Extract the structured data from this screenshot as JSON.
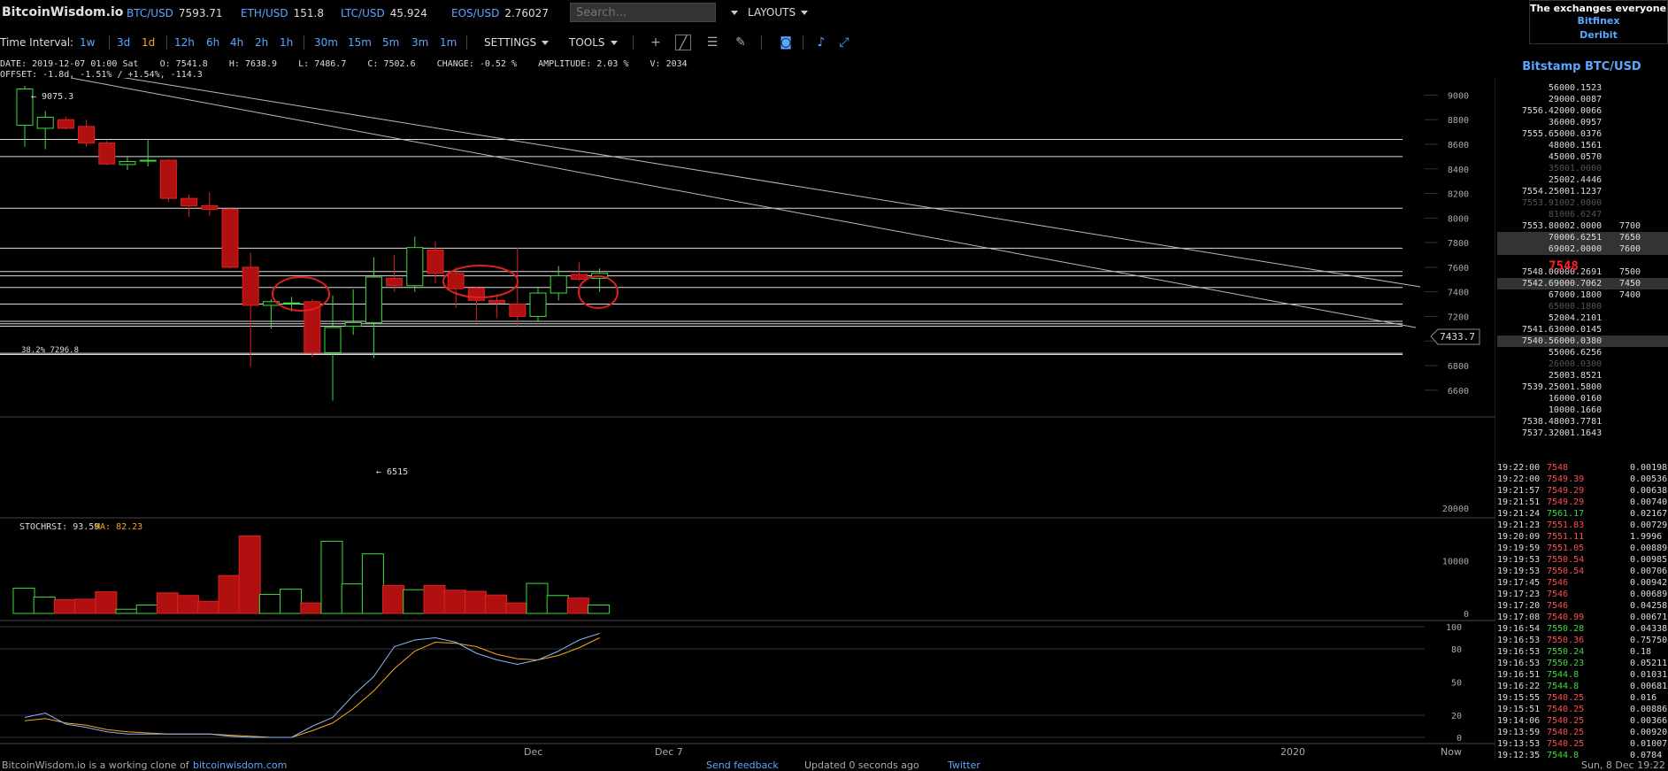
{
  "site": {
    "logo": "BitcoinWisdom.io"
  },
  "tickers": [
    {
      "sym": "BTC/USD",
      "val": "7593.71"
    },
    {
      "sym": "ETH/USD",
      "val": "151.8"
    },
    {
      "sym": "LTC/USD",
      "val": "45.924"
    },
    {
      "sym": "EOS/USD",
      "val": "2.76027"
    }
  ],
  "search": {
    "placeholder": "Search..."
  },
  "layouts_label": "LAYOUTS",
  "ad": {
    "title": "The exchanges everyone us",
    "links": [
      "Bitfinex",
      "Deribit"
    ]
  },
  "toolbar": {
    "time_interval_label": "Time Interval:",
    "intervals": [
      "1w",
      "3d",
      "1d",
      "12h",
      "6h",
      "4h",
      "2h",
      "1h",
      "30m",
      "15m",
      "5m",
      "3m",
      "1m"
    ],
    "active_interval": "1d",
    "settings_label": "SETTINGS",
    "tools_label": "TOOLS",
    "icons": [
      "crosshair-icon",
      "line-tool-icon",
      "fib-tool-icon",
      "pen-tool-icon",
      "camera-icon",
      "bell-icon",
      "fullscreen-icon"
    ]
  },
  "info": {
    "line1": "DATE: 2019-12-07 01:00 Sat    O: 7541.8    H: 7638.9    L: 7486.7    C: 7502.6    CHANGE: -0.52 %    AMPLITUDE: 2.03 %    V: 2034",
    "line2": "OFFSET: -1.8d, -1.51% / +1.54%, -114.3"
  },
  "chart_data": {
    "type": "candlestick",
    "price_axis": {
      "ticks": [
        "9000",
        "8800",
        "8600",
        "8400",
        "8200",
        "8000",
        "7800",
        "7600",
        "7400",
        "7200",
        "7000",
        "6800",
        "6600"
      ],
      "range": [
        6440,
        9140
      ]
    },
    "candles": [
      {
        "o": 8755,
        "h": 9075,
        "l": 8580,
        "c": 9050
      },
      {
        "o": 8730,
        "h": 8870,
        "l": 8560,
        "c": 8820
      },
      {
        "o": 8800,
        "h": 8825,
        "l": 8720,
        "c": 8730
      },
      {
        "o": 8745,
        "h": 8800,
        "l": 8580,
        "c": 8610
      },
      {
        "o": 8610,
        "h": 8630,
        "l": 8430,
        "c": 8440
      },
      {
        "o": 8435,
        "h": 8500,
        "l": 8390,
        "c": 8460
      },
      {
        "o": 8470,
        "h": 8640,
        "l": 8420,
        "c": 8470
      },
      {
        "o": 8470,
        "h": 8480,
        "l": 8130,
        "c": 8160
      },
      {
        "o": 8160,
        "h": 8190,
        "l": 8010,
        "c": 8100
      },
      {
        "o": 8100,
        "h": 8210,
        "l": 8020,
        "c": 8070
      },
      {
        "o": 8070,
        "h": 8090,
        "l": 7590,
        "c": 7600
      },
      {
        "o": 7600,
        "h": 7720,
        "l": 6790,
        "c": 7290
      },
      {
        "o": 7290,
        "h": 7340,
        "l": 7100,
        "c": 7320
      },
      {
        "o": 7310,
        "h": 7360,
        "l": 7240,
        "c": 7310
      },
      {
        "o": 7320,
        "h": 7340,
        "l": 6870,
        "c": 6905
      },
      {
        "o": 6905,
        "h": 7370,
        "l": 6515,
        "c": 7110
      },
      {
        "o": 7120,
        "h": 7420,
        "l": 7050,
        "c": 7150
      },
      {
        "o": 7150,
        "h": 7680,
        "l": 6860,
        "c": 7520
      },
      {
        "o": 7510,
        "h": 7700,
        "l": 7400,
        "c": 7450
      },
      {
        "o": 7450,
        "h": 7850,
        "l": 7400,
        "c": 7760
      },
      {
        "o": 7740,
        "h": 7810,
        "l": 7470,
        "c": 7550
      },
      {
        "o": 7550,
        "h": 7600,
        "l": 7270,
        "c": 7425
      },
      {
        "o": 7430,
        "h": 7440,
        "l": 7150,
        "c": 7330
      },
      {
        "o": 7330,
        "h": 7380,
        "l": 7190,
        "c": 7310
      },
      {
        "o": 7300,
        "h": 7760,
        "l": 7120,
        "c": 7200
      },
      {
        "o": 7200,
        "h": 7430,
        "l": 7160,
        "c": 7390
      },
      {
        "o": 7390,
        "h": 7610,
        "l": 7330,
        "c": 7530
      },
      {
        "o": 7541.8,
        "h": 7638.9,
        "l": 7486.7,
        "c": 7502.6
      },
      {
        "o": 7510,
        "h": 7590,
        "l": 7400,
        "c": 7550
      }
    ],
    "volumes": [
      4800,
      3100,
      2600,
      2700,
      4100,
      800,
      1600,
      3900,
      3400,
      2300,
      7200,
      14700,
      3600,
      4600,
      2000,
      13700,
      5600,
      11300,
      5300,
      4500,
      5300,
      4400,
      4200,
      3500,
      2000,
      5700,
      3400,
      2900,
      1600,
      1000
    ],
    "volume_axis": {
      "ticks": [
        "20000",
        "10000",
        "0"
      ],
      "range": [
        0,
        21000
      ]
    },
    "stochrsi": {
      "label": "STOCHRSI: 93.59",
      "ma_label": "MA: 82.23",
      "k": [
        18,
        22,
        12,
        9,
        5,
        3,
        3,
        3,
        3,
        3,
        1,
        0,
        0,
        0,
        10,
        18,
        38,
        55,
        82,
        88,
        90,
        86,
        76,
        70,
        66,
        70,
        78,
        88,
        94
      ],
      "d": [
        15,
        17,
        13,
        11,
        7,
        5,
        4,
        3,
        3,
        3,
        2,
        1,
        0,
        0,
        6,
        13,
        26,
        42,
        62,
        78,
        86,
        85,
        82,
        75,
        71,
        70,
        74,
        81,
        90
      ],
      "ticks": [
        "100",
        "80",
        "50",
        "20",
        "0"
      ]
    },
    "annotations": {
      "high_label": "← 9075.3",
      "low_label": "← 6515",
      "fib_label": "38.2% 7296.8",
      "price_tag": "7433.7"
    },
    "time_axis": [
      "Dec",
      "Dec 7",
      "2020",
      "Now"
    ]
  },
  "orderbook": {
    "title": "Bitstamp BTC/USD",
    "asks": [
      {
        "p": "5600",
        "a": "0.1523",
        "dim": false,
        "hl": false
      },
      {
        "p": "2900",
        "a": "0.0087",
        "dim": false,
        "hl": false
      },
      {
        "p": "7556.4200",
        "a": "0.0066",
        "dim": false,
        "hl": false
      },
      {
        "p": "3600",
        "a": "0.0957",
        "dim": false,
        "hl": false
      },
      {
        "p": "7555.6500",
        "a": "0.0376",
        "dim": false,
        "hl": false
      },
      {
        "p": "4800",
        "a": "0.1561",
        "dim": false,
        "hl": false
      },
      {
        "p": "4500",
        "a": "0.0570",
        "dim": false,
        "hl": false
      },
      {
        "p": "3500",
        "a": "1.0000",
        "dim": true,
        "hl": false
      },
      {
        "p": "2500",
        "a": "2.4446",
        "dim": false,
        "hl": false
      },
      {
        "p": "7554.2500",
        "a": "1.1237",
        "dim": false,
        "hl": false
      },
      {
        "p": "7553.9100",
        "a": "2.0000",
        "dim": true,
        "hl": false
      },
      {
        "p": "8100",
        "a": "6.6247",
        "dim": true,
        "hl": false
      },
      {
        "p": "7553.8000",
        "a": "2.0000",
        "dim": false,
        "hl": false,
        "d": "7700"
      },
      {
        "p": "7000",
        "a": "6.6251",
        "dim": false,
        "hl": true,
        "d": "7650"
      },
      {
        "p": "6900",
        "a": "2.0000",
        "dim": false,
        "hl": true,
        "d": "7600"
      }
    ],
    "last": "7548",
    "bids": [
      {
        "p": "7548.0000",
        "a": "0.2691",
        "dim": false,
        "hl": false,
        "d": "7500"
      },
      {
        "p": "7542.6900",
        "a": "0.7062",
        "dim": false,
        "hl": true,
        "d": "7450"
      },
      {
        "p": "6700",
        "a": "0.1800",
        "dim": false,
        "hl": false,
        "d": "7400"
      },
      {
        "p": "6500",
        "a": "0.1800",
        "dim": true,
        "hl": false
      },
      {
        "p": "5200",
        "a": "4.2101",
        "dim": false,
        "hl": false
      },
      {
        "p": "7541.6300",
        "a": "0.0145",
        "dim": false,
        "hl": false
      },
      {
        "p": "7540.5600",
        "a": "0.0380",
        "dim": false,
        "hl": true
      },
      {
        "p": "5500",
        "a": "6.6256",
        "dim": false,
        "hl": false
      },
      {
        "p": "2600",
        "a": "0.0300",
        "dim": true,
        "hl": false
      },
      {
        "p": "2500",
        "a": "3.8521",
        "dim": false,
        "hl": false
      },
      {
        "p": "7539.2500",
        "a": "1.5800",
        "dim": false,
        "hl": false
      },
      {
        "p": "1600",
        "a": "0.0160",
        "dim": false,
        "hl": false
      },
      {
        "p": "1000",
        "a": "0.1660",
        "dim": false,
        "hl": false
      },
      {
        "p": "7538.4800",
        "a": "3.7781",
        "dim": false,
        "hl": false
      },
      {
        "p": "7537.3200",
        "a": "1.1643",
        "dim": false,
        "hl": false
      }
    ]
  },
  "trades": [
    {
      "t": "19:22:00",
      "p": "7548",
      "dir": "dn",
      "a": "0.00198"
    },
    {
      "t": "19:22:00",
      "p": "7549.39",
      "dir": "dn",
      "a": "0.00536"
    },
    {
      "t": "19:21:57",
      "p": "7549.29",
      "dir": "dn",
      "a": "0.00638"
    },
    {
      "t": "19:21:51",
      "p": "7549.29",
      "dir": "dn",
      "a": "0.00740"
    },
    {
      "t": "19:21:24",
      "p": "7561.17",
      "dir": "up",
      "a": "0.02167"
    },
    {
      "t": "19:21:23",
      "p": "7551.83",
      "dir": "dn",
      "a": "0.00729"
    },
    {
      "t": "19:20:09",
      "p": "7551.11",
      "dir": "dn",
      "a": "1.9996"
    },
    {
      "t": "19:19:59",
      "p": "7551.05",
      "dir": "dn",
      "a": "0.00889"
    },
    {
      "t": "19:19:53",
      "p": "7550.54",
      "dir": "dn",
      "a": "0.00985"
    },
    {
      "t": "19:19:53",
      "p": "7550.54",
      "dir": "dn",
      "a": "0.00706"
    },
    {
      "t": "19:17:45",
      "p": "7546",
      "dir": "dn",
      "a": "0.00942"
    },
    {
      "t": "19:17:23",
      "p": "7546",
      "dir": "dn",
      "a": "0.00689"
    },
    {
      "t": "19:17:20",
      "p": "7546",
      "dir": "dn",
      "a": "0.04258"
    },
    {
      "t": "19:17:08",
      "p": "7540.99",
      "dir": "dn",
      "a": "0.00671"
    },
    {
      "t": "19:16:54",
      "p": "7550.28",
      "dir": "up",
      "a": "0.04338"
    },
    {
      "t": "19:16:53",
      "p": "7550.36",
      "dir": "dn",
      "a": "0.75750"
    },
    {
      "t": "19:16:53",
      "p": "7550.24",
      "dir": "up",
      "a": "0.18"
    },
    {
      "t": "19:16:53",
      "p": "7550.23",
      "dir": "up",
      "a": "0.05211"
    },
    {
      "t": "19:16:51",
      "p": "7544.8",
      "dir": "up",
      "a": "0.01031"
    },
    {
      "t": "19:16:22",
      "p": "7544.8",
      "dir": "up",
      "a": "0.00681"
    },
    {
      "t": "19:15:55",
      "p": "7540.25",
      "dir": "dn",
      "a": "0.016"
    },
    {
      "t": "19:15:51",
      "p": "7540.25",
      "dir": "dn",
      "a": "0.00886"
    },
    {
      "t": "19:14:06",
      "p": "7540.25",
      "dir": "dn",
      "a": "0.00366"
    },
    {
      "t": "19:13:59",
      "p": "7540.25",
      "dir": "dn",
      "a": "0.00920"
    },
    {
      "t": "19:13:53",
      "p": "7540.25",
      "dir": "dn",
      "a": "0.01007"
    },
    {
      "t": "19:12:35",
      "p": "7544.8",
      "dir": "up",
      "a": "0.0784"
    }
  ],
  "footer": {
    "text1": "BitcoinWisdom.io is a working clone of",
    "link1": "bitcoinwisdom.com",
    "feedback": "Send feedback",
    "updated": "Updated 0 seconds ago",
    "twitter": "Twitter",
    "clock": "Sun, 8 Dec 19:22"
  }
}
